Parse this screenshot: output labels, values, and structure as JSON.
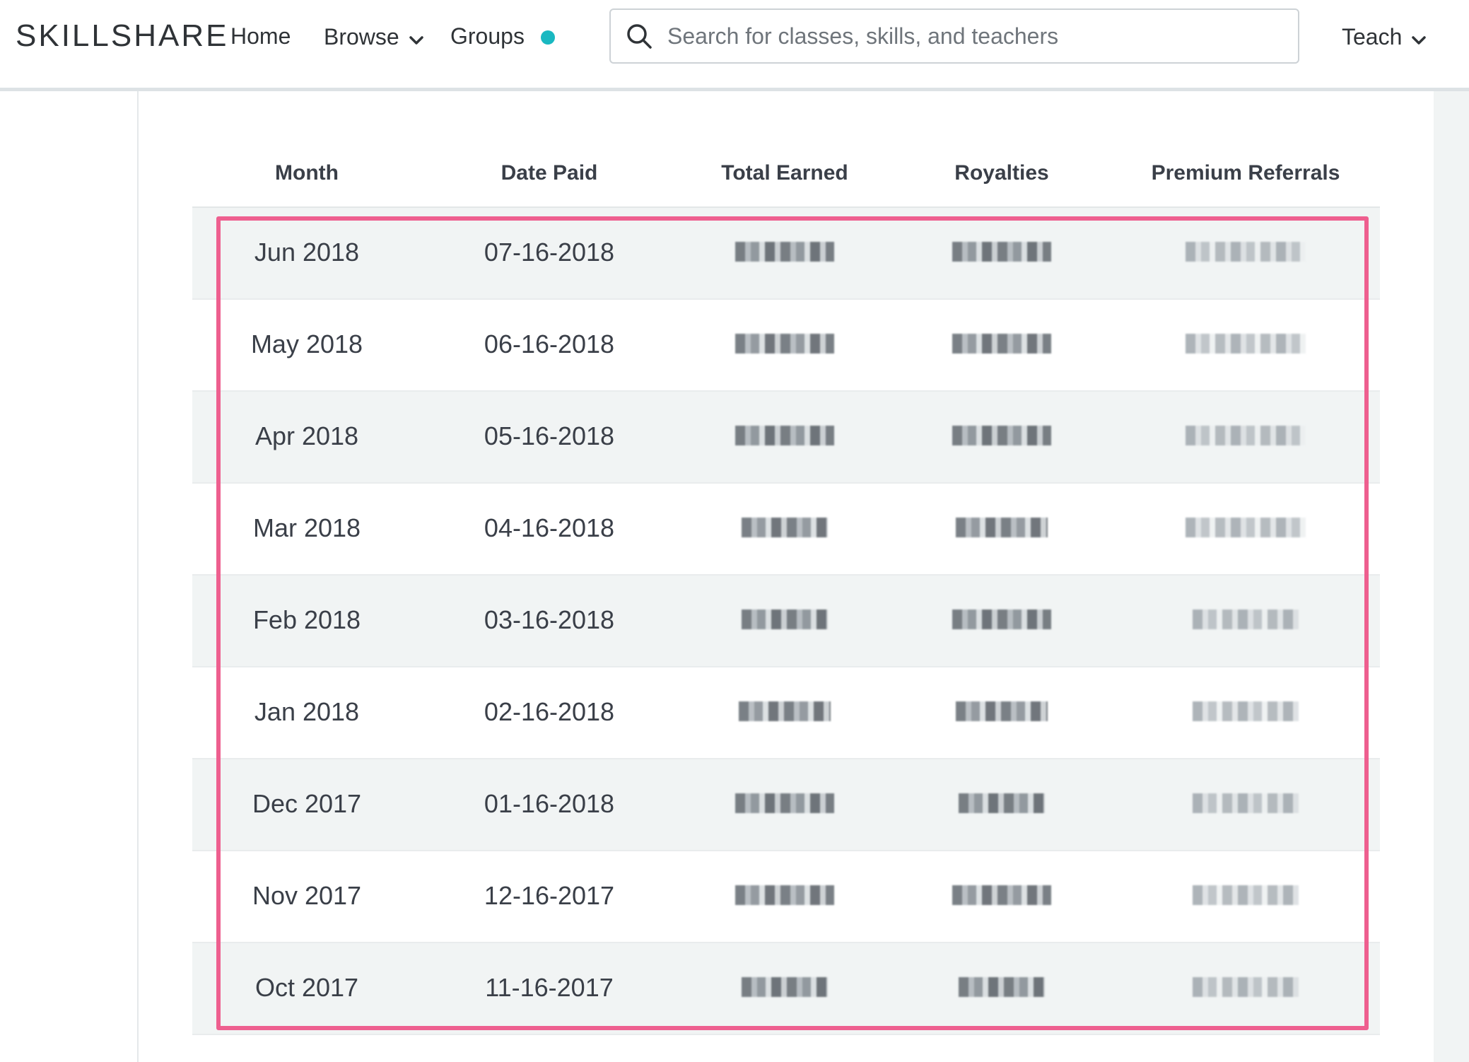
{
  "header": {
    "logo": "SKILLSHARE",
    "nav": {
      "home": "Home",
      "browse": "Browse",
      "groups": "Groups",
      "teach": "Teach"
    },
    "search_placeholder": "Search for classes, skills, and teachers",
    "notification_dot_color": "#19b8c1"
  },
  "table": {
    "columns": [
      "Month",
      "Date Paid",
      "Total Earned",
      "Royalties",
      "Premium Referrals"
    ],
    "rows": [
      {
        "month": "Jun 2018",
        "date_paid": "07-16-2018"
      },
      {
        "month": "May 2018",
        "date_paid": "06-16-2018"
      },
      {
        "month": "Apr 2018",
        "date_paid": "05-16-2018"
      },
      {
        "month": "Mar 2018",
        "date_paid": "04-16-2018"
      },
      {
        "month": "Feb 2018",
        "date_paid": "03-16-2018"
      },
      {
        "month": "Jan 2018",
        "date_paid": "02-16-2018"
      },
      {
        "month": "Dec 2017",
        "date_paid": "01-16-2018"
      },
      {
        "month": "Nov 2017",
        "date_paid": "12-16-2017"
      },
      {
        "month": "Oct 2017",
        "date_paid": "11-16-2017"
      }
    ],
    "amounts_obscured": true
  },
  "colors": {
    "highlight_border": "#ee5f8f",
    "row_alt_bg": "#f1f4f4"
  }
}
